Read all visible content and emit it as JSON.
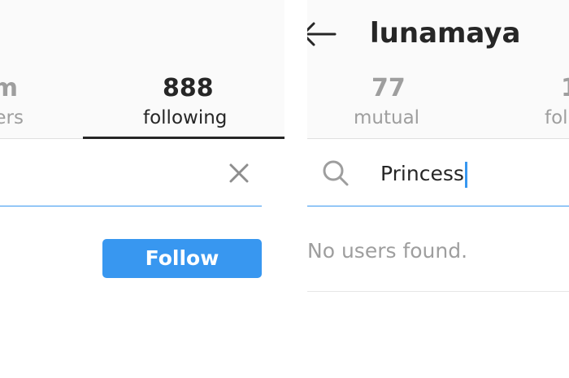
{
  "left_panel": {
    "stats": [
      {
        "count": "m",
        "label": "ers"
      },
      {
        "count": "888",
        "label": "following"
      }
    ],
    "clear_icon": "close-icon",
    "follow_button": "Follow"
  },
  "right_panel": {
    "back_icon": "arrow-left-icon",
    "username": "lunamaya",
    "stats": [
      {
        "count": "77",
        "label": "mutual"
      },
      {
        "count": "1",
        "label": "fol"
      }
    ],
    "search": {
      "icon": "search-icon",
      "value": "Princess"
    },
    "empty_message": "No users found."
  },
  "colors": {
    "accent": "#3897f0",
    "text": "#262626",
    "muted": "#9e9e9e",
    "header_bg": "#fafafa"
  }
}
